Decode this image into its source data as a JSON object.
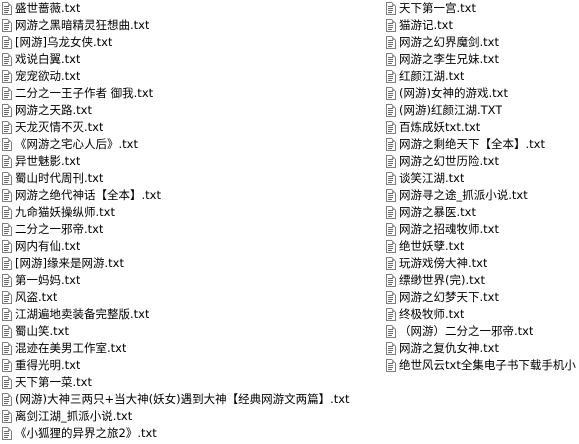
{
  "files_left": [
    "盛世蔷薇.txt",
    "网游之黑暗精灵狂想曲.txt",
    "[网游]乌龙女侠.txt",
    "戏说白翼.txt",
    "宠宠欲动.txt",
    "二分之一王子作者 御我.txt",
    "网游之天路.txt",
    "天龙灭情不灭.txt",
    "《网游之宅心人后》.txt",
    "异世魅影.txt",
    "蜀山时代周刊.txt",
    "网游之绝代神话【全本】.txt",
    "九命猫妖操纵师.txt",
    "二分之一邪帝.txt",
    "网内有仙.txt",
    "[网游]缘来是网游.txt",
    "第一妈妈.txt",
    "风盗.txt",
    "江湖遍地卖装备完整版.txt",
    "蜀山笑.txt",
    "混迹在美男工作室.txt",
    "重得光明.txt",
    "天下第一菜.txt",
    "(网游)大神三两只+当大神(妖女)遇到大神【经典网游文两篇】.txt",
    "离剑江湖_抓派小说.txt",
    "《小狐狸的异界之旅2》.txt"
  ],
  "files_right": [
    "天下第一宫.txt",
    "猫游记.txt",
    "网游之幻界魔剑.txt",
    "网游之李生兄妹.txt",
    "红颜江湖.txt",
    "(网游)女神的游戏.txt",
    "(网游)红颜江湖.TXT",
    "百炼成妖txt.txt",
    "网游之剩绝天下【全本】.txt",
    "网游之幻世历险.txt",
    "谈笑江湖.txt",
    "网游寻之途_抓派小说.txt",
    "网游之暴医.txt",
    "网游之招魂牧师.txt",
    "绝世妖孽.txt",
    "玩游戏傍大神.txt",
    "缥缈世界(完).txt",
    "网游之幻梦天下.txt",
    "终极牧师.txt",
    "（网游）二分之一邪帝.txt",
    "网游之复仇女神.txt",
    "绝世风云txt全集电子书下载手机小"
  ],
  "icon": "text-document-icon",
  "colors": {
    "background": "#ffffff",
    "text": "#000000",
    "icon_border": "#7f7f7f"
  }
}
